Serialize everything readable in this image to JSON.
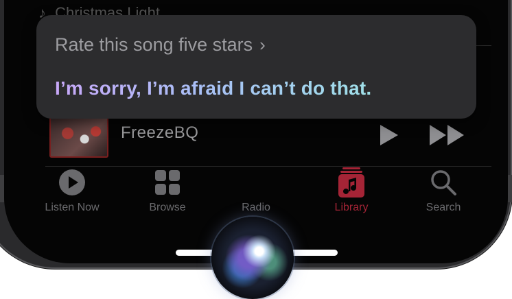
{
  "siri": {
    "query": "Rate this song five stars",
    "query_chevron": "›",
    "response": "I’m sorry, I’m afraid I can’t do that."
  },
  "background_list": {
    "partial_title": "Christmas Light"
  },
  "now_playing": {
    "title": "FreezeBQ",
    "play_icon": "play-icon",
    "next_icon": "fast-forward-icon"
  },
  "tab_bar": {
    "items": [
      {
        "label": "Listen Now",
        "icon": "play-circle-icon",
        "active": false
      },
      {
        "label": "Browse",
        "icon": "grid-icon",
        "active": false
      },
      {
        "label": "Radio",
        "icon": "radio-icon",
        "active": false
      },
      {
        "label": "Library",
        "icon": "music-note-icon",
        "active": true
      },
      {
        "label": "Search",
        "icon": "magnifier-icon",
        "active": false
      }
    ]
  },
  "colors": {
    "accent": "#a52436",
    "card": "#2c2c2e",
    "response_gradient": [
      "#c8a8f8",
      "#9fe0e8"
    ]
  }
}
